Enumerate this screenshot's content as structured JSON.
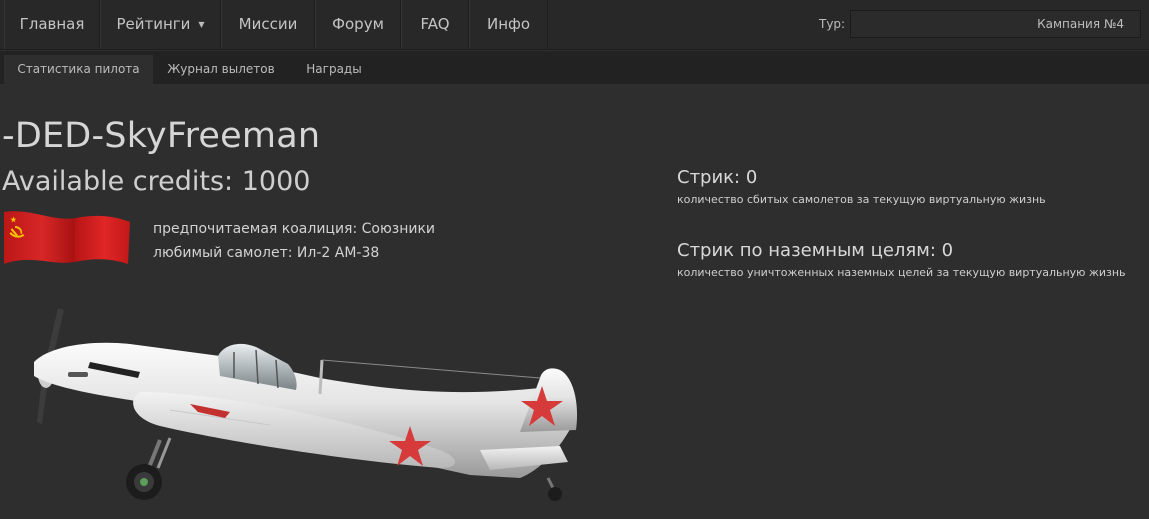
{
  "nav": {
    "items": [
      {
        "label": "Главная"
      },
      {
        "label": "Рейтинги"
      },
      {
        "label": "Миссии"
      },
      {
        "label": "Форум"
      },
      {
        "label": "FAQ"
      },
      {
        "label": "Инфо"
      }
    ],
    "tour_label": "Тур:",
    "tour_value": "Кампания №4"
  },
  "tabs": [
    {
      "label": "Статистика пилота",
      "active": true
    },
    {
      "label": "Журнал вылетов",
      "active": false
    },
    {
      "label": "Награды",
      "active": false
    }
  ],
  "pilot": {
    "name": "-DED-SkyFreeman",
    "credits": "Available credits: 1000",
    "coalition": "предпочитаемая коалиция: Союзники",
    "favorite_plane": "любимый самолет: Ил-2 АМ-38",
    "flag_icon": "ussr-flag-icon",
    "plane_icon": "il-2-aircraft-image"
  },
  "streaks": {
    "air": {
      "title": "Стрик: 0",
      "desc": "количество сбитых самолетов за текущую виртуальную жизнь"
    },
    "ground": {
      "title": "Стрик по наземным целям: 0",
      "desc": "количество уничтоженных наземных целей за текущую виртуальную жизнь"
    }
  },
  "colors": {
    "background": "#2e2e2e",
    "nav_background": "#282828",
    "flag_red": "#d91f1f",
    "star_red": "#d63a3a"
  }
}
